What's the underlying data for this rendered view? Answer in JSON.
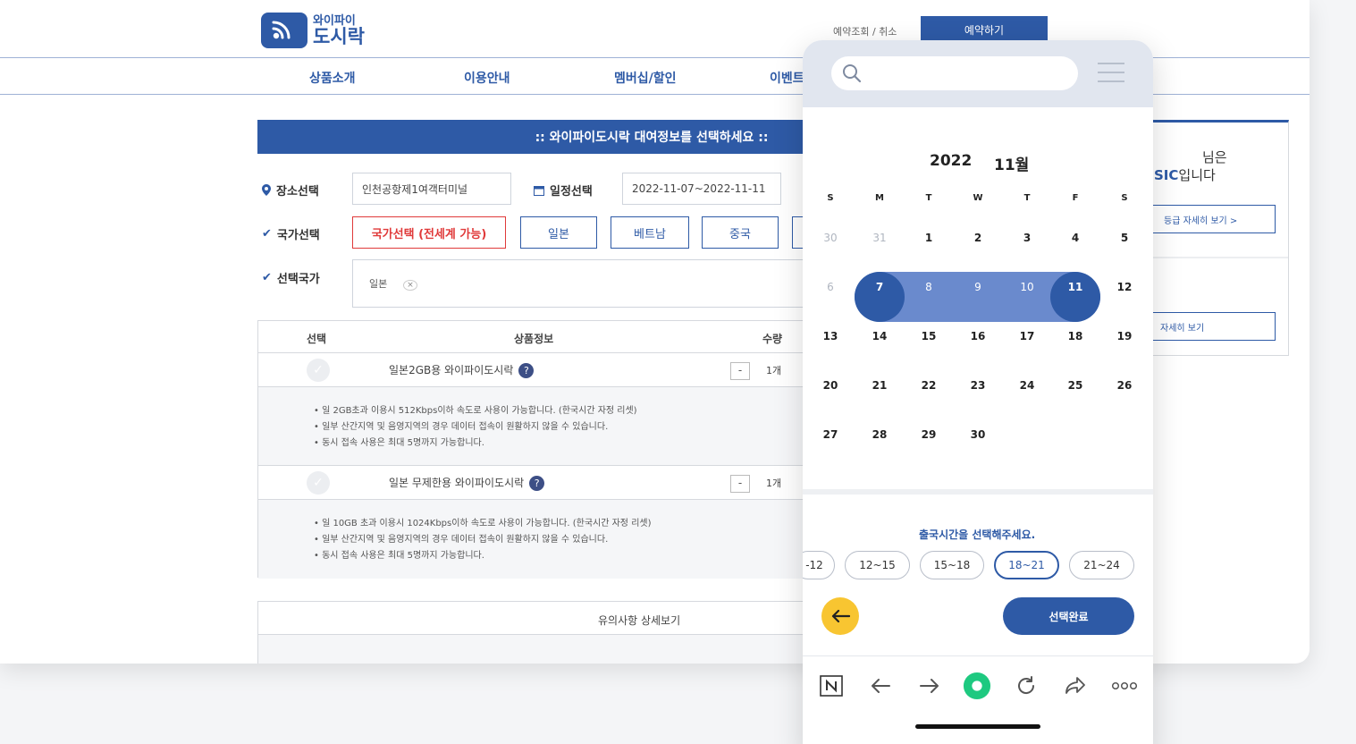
{
  "brand": {
    "name_line1": "와이파이",
    "name_line2": "도시락",
    "color": "#2e5aa6"
  },
  "header": {
    "lookup_link": "예약조회 / 취소",
    "reserve_button": "예약하기"
  },
  "gnb": {
    "items": [
      "상품소개",
      "이용안내",
      "멤버십/할인",
      "이벤트"
    ]
  },
  "form": {
    "banner": ":: 와이파이도시락 대여정보를 선택하세요 ::",
    "place_label": "장소선택",
    "place_value": "인천공항제1여객터미널",
    "date_label": "일정선택",
    "date_value": "2022-11-07~2022-11-11",
    "country_label": "국가선택",
    "country_buttons": [
      "국가선택 (전세계 가능)",
      "일본",
      "베트남",
      "중국"
    ],
    "selected_label": "선택국가",
    "selected_chip": "일본",
    "chip_close": "×"
  },
  "table": {
    "headers": [
      "선택",
      "상품정보",
      "수량"
    ],
    "products": [
      {
        "name": "일본2GB용 와이파이도시락",
        "qty": "1개",
        "desc": [
          "• 일 2GB초과 이용시 512Kbps이하 속도로 사용이 가능합니다. (한국시간 자정 리셋)",
          "• 일부 산간지역 및 음영지역의 경우 데이터 접속이 원활하지 않을 수 있습니다.",
          "• 동시 접속 사용은 최대 5명까지 가능합니다."
        ]
      },
      {
        "name": "일본 무제한용 와이파이도시락",
        "qty": "1개",
        "desc": [
          "• 일 10GB 초과 이용시 1024Kbps이하 속도로 사용이 가능합니다. (한국시간 자정 리셋)",
          "• 일부 산간지역 및 음영지역의 경우 데이터 접속이 원활하지 않을 수 있습니다.",
          "• 동시 접속 사용은 최대 5명까지 가능합니다."
        ]
      }
    ],
    "notice": "유의사항 상세보기"
  },
  "member": {
    "line1": "님은",
    "line2_prefix": "SIC",
    "line2_suffix": "입니다",
    "grade_button": "등급 자세히 보기    >",
    "detail_button": "자세히 보기"
  },
  "calendar": {
    "year": "2022",
    "month": "11월",
    "weekdays": [
      "S",
      "M",
      "T",
      "W",
      "T",
      "F",
      "S"
    ],
    "weeks": [
      [
        "30",
        "31",
        "1",
        "2",
        "3",
        "4",
        "5"
      ],
      [
        "6",
        "7",
        "8",
        "9",
        "10",
        "11",
        "12"
      ],
      [
        "13",
        "14",
        "15",
        "16",
        "17",
        "18",
        "19"
      ],
      [
        "20",
        "21",
        "22",
        "23",
        "24",
        "25",
        "26"
      ],
      [
        "27",
        "28",
        "29",
        "30",
        "",
        "",
        ""
      ]
    ],
    "range_start": "7",
    "range_end": "11"
  },
  "departure": {
    "prompt": "출국시간을 선택해주세요.",
    "slots": [
      "-12",
      "12~15",
      "15~18",
      "18~21",
      "21~24"
    ],
    "selected": "18~21",
    "done_button": "선택완료"
  },
  "browser_nav": [
    "naver-icon",
    "back-icon",
    "forward-icon",
    "home-icon",
    "reload-icon",
    "share-icon",
    "more-icon"
  ],
  "accents": {
    "primary": "#2e5aa6",
    "range": "#6a8acd",
    "yellow": "#f8c531",
    "red": "#e03a3a"
  }
}
